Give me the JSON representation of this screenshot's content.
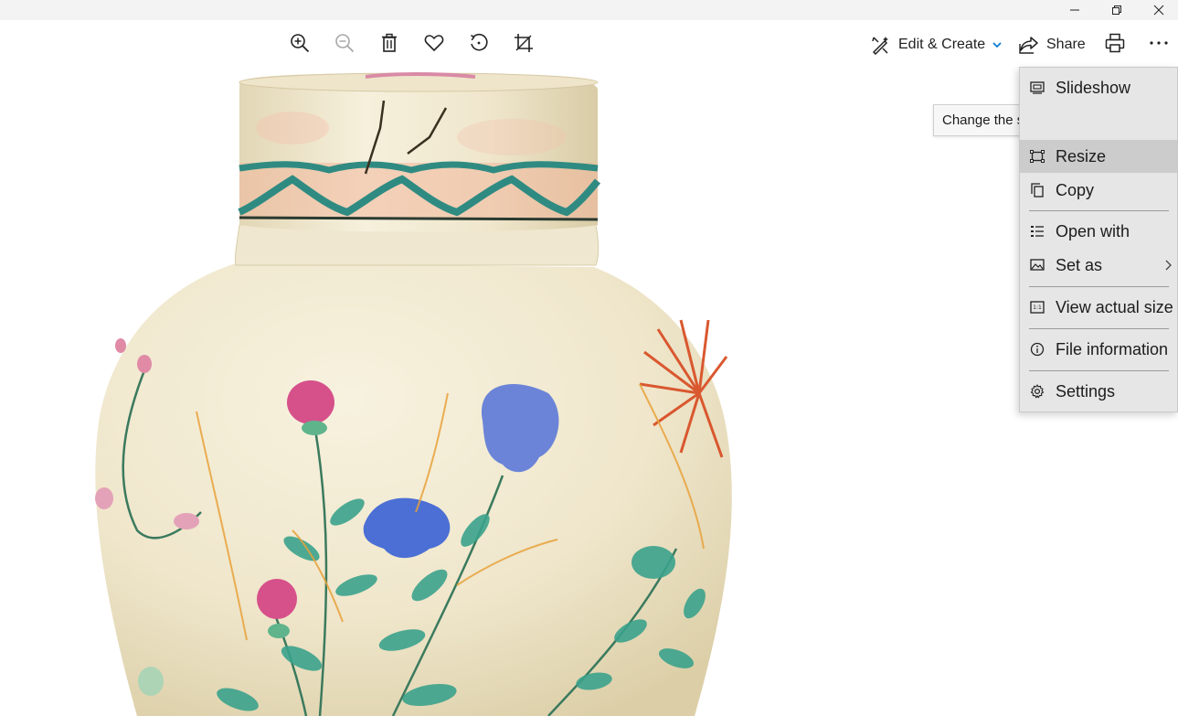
{
  "toolbar": {
    "edit_create_label": "Edit & Create",
    "share_label": "Share"
  },
  "menu": {
    "items": [
      {
        "label": "Slideshow",
        "icon": "slideshow-icon"
      },
      {
        "label": "Resize",
        "icon": "resize-icon"
      },
      {
        "label": "Copy",
        "icon": "copy-icon"
      },
      {
        "label": "Open with",
        "icon": "open-with-icon"
      },
      {
        "label": "Set as",
        "icon": "set-as-icon"
      },
      {
        "label": "View actual size",
        "icon": "actual-size-icon"
      },
      {
        "label": "File information",
        "icon": "info-icon"
      },
      {
        "label": "Settings",
        "icon": "gear-icon"
      }
    ],
    "tooltip": "Change the size of your picture"
  },
  "colors": {
    "accent": "#0078d4",
    "menu_bg": "#e6e6e6",
    "menu_hover": "#cccccc",
    "titlebar_bg": "#f3f3f3"
  }
}
